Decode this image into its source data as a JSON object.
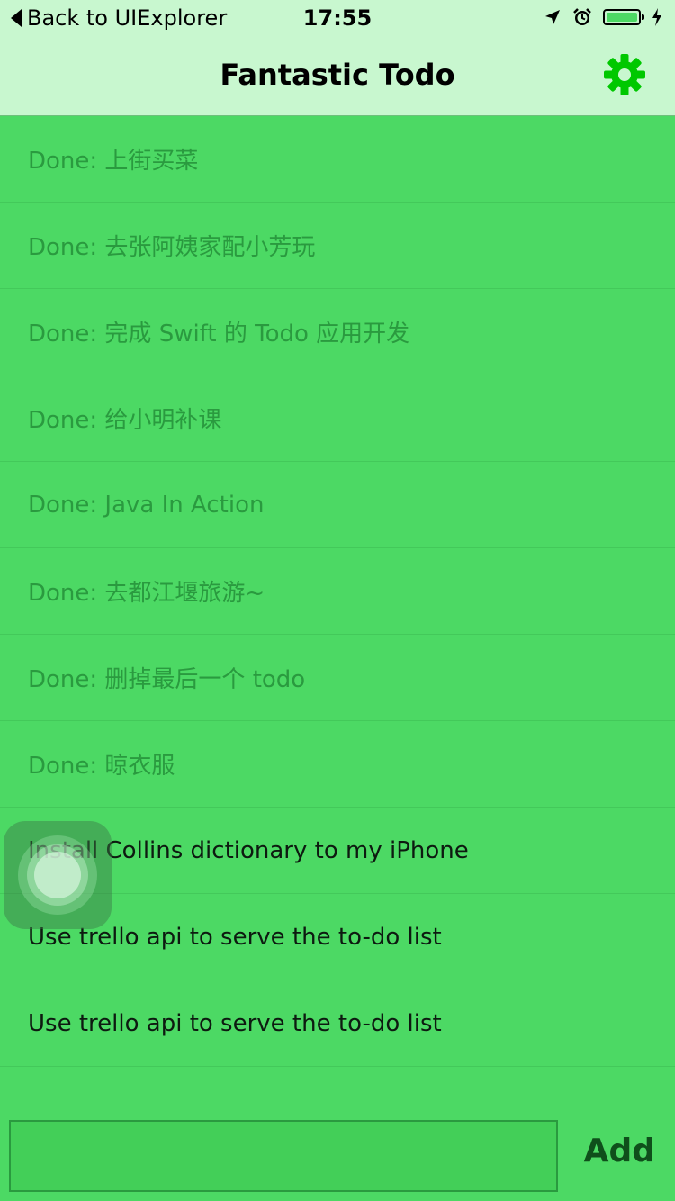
{
  "status_bar": {
    "back_label": "Back to UIExplorer",
    "time": "17:55",
    "icons": [
      "location-arrow-icon",
      "alarm-icon",
      "battery-icon",
      "charging-icon"
    ]
  },
  "nav": {
    "title": "Fantastic Todo",
    "settings_icon": "gear-icon",
    "accent_color": "#00c800"
  },
  "todos": [
    {
      "text": "Done: 上街买菜",
      "done": true
    },
    {
      "text": "Done: 去张阿姨家配小芳玩",
      "done": true
    },
    {
      "text": "Done: 完成 Swift 的 Todo 应用开发",
      "done": true
    },
    {
      "text": "Done: 给小明补课",
      "done": true
    },
    {
      "text": "Done: Java In Action",
      "done": true
    },
    {
      "text": "Done: 去都江堰旅游~",
      "done": true
    },
    {
      "text": "Done: 删掉最后一个 todo",
      "done": true
    },
    {
      "text": "Done: 晾衣服",
      "done": true
    },
    {
      "text": "Install Collins dictionary to my iPhone",
      "done": false
    },
    {
      "text": "Use trello api to serve the to-do list",
      "done": false
    },
    {
      "text": "Use trello api to serve the to-do list",
      "done": false
    }
  ],
  "input": {
    "value": "",
    "placeholder": ""
  },
  "add_button_label": "Add",
  "colors": {
    "background": "#4cd964",
    "header": "#c8f7cf",
    "done_text": "#2a9a3f",
    "active_text": "#0d1a10"
  }
}
